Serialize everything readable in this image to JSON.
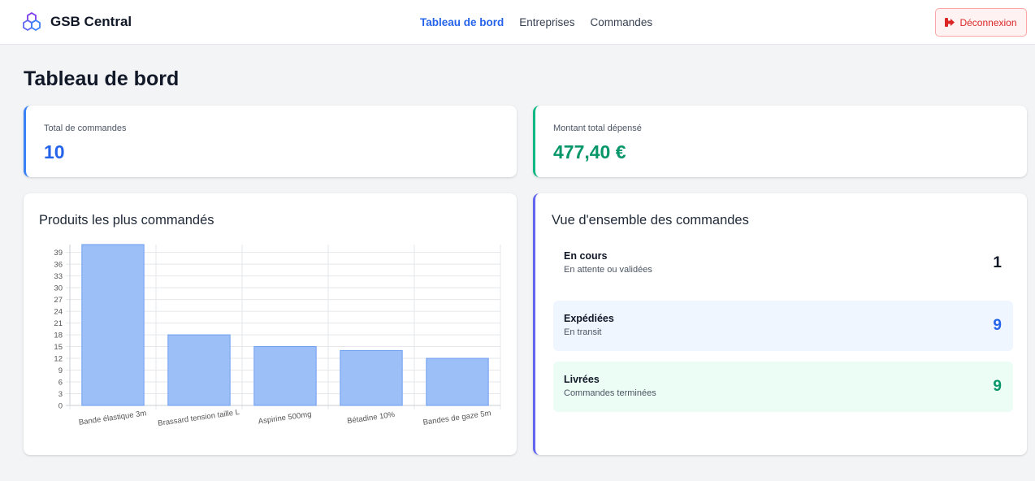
{
  "navbar": {
    "brand": "GSB Central",
    "links": [
      {
        "label": "Tableau de bord",
        "active": true
      },
      {
        "label": "Entreprises",
        "active": false
      },
      {
        "label": "Commandes",
        "active": false
      }
    ],
    "logout_label": "Déconnexion"
  },
  "page": {
    "title": "Tableau de bord"
  },
  "stats": {
    "orders": {
      "label": "Total de commandes",
      "value": "10",
      "accent": "#3b82f6",
      "value_color": "#2563eb"
    },
    "spent": {
      "label": "Montant total dépensé",
      "value": "477,40 €",
      "accent": "#10b981",
      "value_color": "#059669"
    }
  },
  "products_card": {
    "title": "Produits les plus commandés"
  },
  "chart_data": {
    "type": "bar",
    "categories": [
      "Bande élastique 3m",
      "Brassard tension taille L",
      "Aspirine 500mg",
      "Bétadine 10%",
      "Bandes de gaze 5m"
    ],
    "values": [
      41,
      18,
      15,
      14,
      12
    ],
    "ylim": [
      0,
      41
    ],
    "yticks": [
      0,
      3,
      6,
      9,
      12,
      15,
      18,
      21,
      24,
      27,
      30,
      33,
      36,
      39
    ],
    "grid": true,
    "bar_fill": "#9dbff7",
    "bar_stroke": "#6b9cf0"
  },
  "overview": {
    "title": "Vue d'ensemble des commandes",
    "accent": "#6366f1",
    "rows": [
      {
        "title": "En cours",
        "subtitle": "En attente ou validées",
        "count": "1",
        "bg": "#ffffff",
        "color": "#111827"
      },
      {
        "title": "Expédiées",
        "subtitle": "En transit",
        "count": "9",
        "bg": "#eff6ff",
        "color": "#2563eb"
      },
      {
        "title": "Livrées",
        "subtitle": "Commandes terminées",
        "count": "9",
        "bg": "#ecfdf5",
        "color": "#059669"
      }
    ]
  },
  "icons": {
    "brand": "hexagon-logo-icon",
    "logout": "sign-out-icon"
  }
}
